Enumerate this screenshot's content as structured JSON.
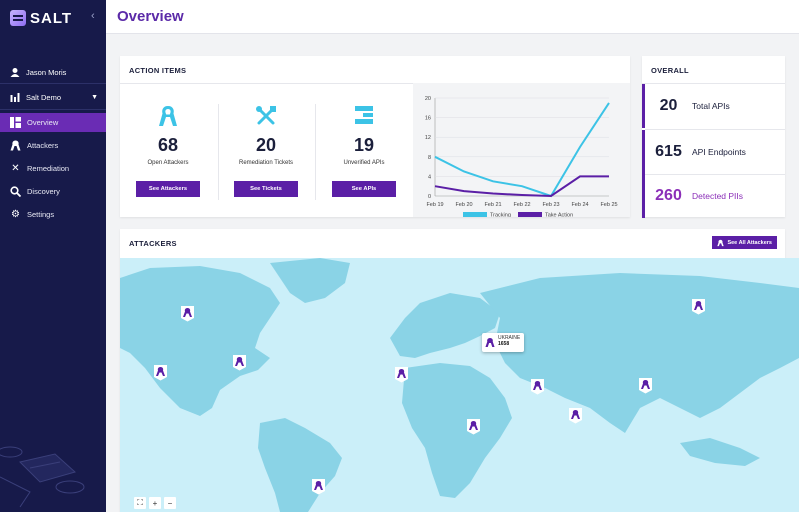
{
  "sidebar": {
    "logo": "SALT",
    "user": "Jason Moris",
    "org": "Salt Demo",
    "items": [
      {
        "label": "Overview",
        "icon": "overview-icon"
      },
      {
        "label": "Attackers",
        "icon": "attacker-icon"
      },
      {
        "label": "Remediation",
        "icon": "tools-icon"
      },
      {
        "label": "Discovery",
        "icon": "search-icon"
      },
      {
        "label": "Settings",
        "icon": "gear-icon"
      }
    ]
  },
  "header": {
    "title": "Overview"
  },
  "action_items": {
    "title": "ACTION ITEMS",
    "stats": [
      {
        "value": "68",
        "label": "Open Attackers",
        "button": "See Attackers",
        "icon": "attacker-icon"
      },
      {
        "value": "20",
        "label": "Remediation Tickets",
        "button": "See Tickets",
        "icon": "tools-icon"
      },
      {
        "value": "19",
        "label": "Unverified APIs",
        "button": "See APIs",
        "icon": "api-icon"
      }
    ]
  },
  "chart_data": {
    "type": "line",
    "x": [
      "Feb 19",
      "Feb 20",
      "Feb 21",
      "Feb 22",
      "Feb 23",
      "Feb 24",
      "Feb 25"
    ],
    "ylim": [
      0,
      20
    ],
    "yticks": [
      0,
      4,
      8,
      12,
      16,
      20
    ],
    "series": [
      {
        "name": "Tracking",
        "color": "#3cc3e6",
        "values": [
          8,
          5,
          3,
          2,
          0,
          10,
          19
        ]
      },
      {
        "name": "Take Action",
        "color": "#5b1fa6",
        "values": [
          2,
          1,
          0.5,
          0.2,
          0,
          4,
          4
        ]
      }
    ],
    "legend": "bottom"
  },
  "overall": {
    "title": "OVERALL",
    "rows": [
      {
        "value": "20",
        "label": "Total APIs"
      },
      {
        "value": "615",
        "label": "API Endpoints"
      },
      {
        "value": "260",
        "label": "Detected PIIs"
      }
    ]
  },
  "attackers": {
    "title": "ATTACKERS",
    "button": "See All Attackers",
    "tooltip": {
      "country": "UKRAINE",
      "count": "1658"
    },
    "zoom": {
      "fit": "⛶",
      "in": "+",
      "out": "−"
    }
  },
  "colors": {
    "brand": "#5b1fa6",
    "sidebar": "#171a4a",
    "tracking": "#3cc3e6",
    "map_water": "#cbeff9",
    "map_land": "#8ad3e6"
  }
}
